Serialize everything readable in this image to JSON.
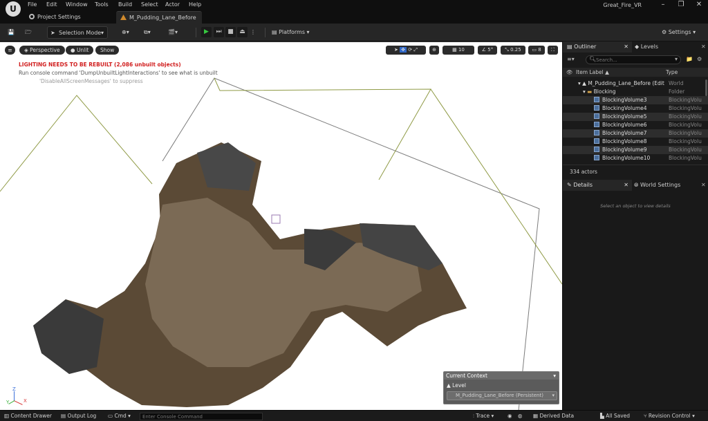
{
  "menu": [
    "File",
    "Edit",
    "Window",
    "Tools",
    "Build",
    "Select",
    "Actor",
    "Help"
  ],
  "app_title": "Great_Fire_VR",
  "tabs": {
    "project_settings": "Project Settings",
    "level": "M_Pudding_Lane_Before"
  },
  "toolbar": {
    "selection_mode": "Selection Mode",
    "platforms": "Platforms",
    "settings": "Settings"
  },
  "viewport": {
    "perspective": "Perspective",
    "unlit": "Unlit",
    "show": "Show",
    "grid_value": "10",
    "angle_value": "5°",
    "scale_value": "0.25",
    "camera_speed": "8",
    "warning": "LIGHTING NEEDS TO BE REBUILT (2,086 unbuilt objects)",
    "console_hint": "Run console command 'DumpUnbuiltLightInteractions' to see what is unbuilt",
    "suppress_hint": "'DisableAllScreenMessages' to suppress",
    "axis": {
      "x": "X",
      "y": "Y",
      "z": "Z"
    }
  },
  "context": {
    "title": "Current Context",
    "level_label": "Level",
    "level_value": "M_Pudding_Lane_Before (Persistent)"
  },
  "outliner": {
    "tab": "Outliner",
    "levels_tab": "Levels",
    "search_placeholder": "Search...",
    "col_label": "Item Label ▲",
    "col_type": "Type",
    "rows": [
      {
        "label": "M_Pudding_Lane_Before (Edit",
        "type": "World"
      },
      {
        "label": "Blocking",
        "type": "Folder"
      },
      {
        "label": "BlockingVolume3",
        "type": "BlockingVolu"
      },
      {
        "label": "BlockingVolume4",
        "type": "BlockingVolu"
      },
      {
        "label": "BlockingVolume5",
        "type": "BlockingVolu"
      },
      {
        "label": "BlockingVolume6",
        "type": "BlockingVolu"
      },
      {
        "label": "BlockingVolume7",
        "type": "BlockingVolu"
      },
      {
        "label": "BlockingVolume8",
        "type": "BlockingVolu"
      },
      {
        "label": "BlockingVolume9",
        "type": "BlockingVolu"
      },
      {
        "label": "BlockingVolume10",
        "type": "BlockingVolu"
      }
    ],
    "actor_count": "334 actors"
  },
  "details": {
    "tab": "Details",
    "world_settings_tab": "World Settings",
    "empty_hint": "Select an object to view details"
  },
  "bottom": {
    "content_drawer": "Content Drawer",
    "output_log": "Output Log",
    "cmd": "Cmd",
    "console_placeholder": "Enter Console Command",
    "trace": "Trace",
    "derived_data": "Derived Data",
    "all_saved": "All Saved",
    "revision_control": "Revision Control"
  }
}
